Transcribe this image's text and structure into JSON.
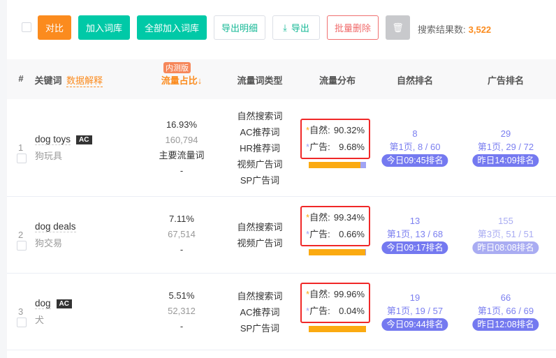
{
  "toolbar": {
    "compare": "对比",
    "add_lib": "加入词库",
    "add_all_lib": "全部加入词库",
    "export_detail": "导出明细",
    "export": "导出",
    "batch_delete": "批量删除",
    "result_label": "搜索结果数:",
    "result_count": "3,522"
  },
  "header": {
    "index": "#",
    "keyword": "关键词",
    "data_explain": "数据解释",
    "beta": "内测版",
    "share": "流量占比↓",
    "type": "流量词类型",
    "dist": "流量分布",
    "organic_rank": "自然排名",
    "ad_rank": "广告排名"
  },
  "labels": {
    "organic": "自然:",
    "ad": "广告:",
    "star": "*"
  },
  "colors": {
    "orange": "#fb8b1e",
    "green": "#00c9a7",
    "organic_bar": "#fbaa11",
    "ad_bar": "#a0a4f5",
    "rank": "#7b7ff0"
  },
  "rows": [
    {
      "index": "1",
      "keyword": "dog toys",
      "badge": "AC",
      "cn": "狗玩具",
      "share": "16.93%",
      "volume": "160,794",
      "main": "主要流量词",
      "dash": "-",
      "types": [
        "自然搜索词",
        "AC推荐词",
        "HR推荐词",
        "视频广告词",
        "SP广告词"
      ],
      "organic_pct": "90.32%",
      "ad_pct": "9.68%",
      "organic_frac": 0.9032,
      "org_rank": "8",
      "org_page": "第1页, 8 / 60",
      "org_time": "今日09:45排名",
      "ad_rank": "29",
      "ad_page": "第1页, 29 / 72",
      "ad_time": "昨日14:09排名"
    },
    {
      "index": "2",
      "keyword": "dog deals",
      "cn": "狗交易",
      "share": "7.11%",
      "volume": "67,514",
      "dash": "-",
      "types": [
        "自然搜索词",
        "视频广告词"
      ],
      "organic_pct": "99.34%",
      "ad_pct": "0.66%",
      "organic_frac": 0.9934,
      "org_rank": "13",
      "org_page": "第1页, 13 / 68",
      "org_time": "今日09:17排名",
      "ad_rank": "155",
      "ad_page": "第3页, 51 / 51",
      "ad_time": "昨日08:08排名"
    },
    {
      "index": "3",
      "keyword": "dog",
      "badge": "AC",
      "cn": "犬",
      "share": "5.51%",
      "volume": "52,312",
      "dash": "-",
      "types": [
        "自然搜索词",
        "AC推荐词",
        "SP广告词"
      ],
      "organic_pct": "99.96%",
      "ad_pct": "0.04%",
      "organic_frac": 0.9996,
      "org_rank": "19",
      "org_page": "第1页, 19 / 57",
      "org_time": "今日09:44排名",
      "ad_rank": "66",
      "ad_page": "第1页, 66 / 69",
      "ad_time": "昨日12:08排名"
    }
  ]
}
